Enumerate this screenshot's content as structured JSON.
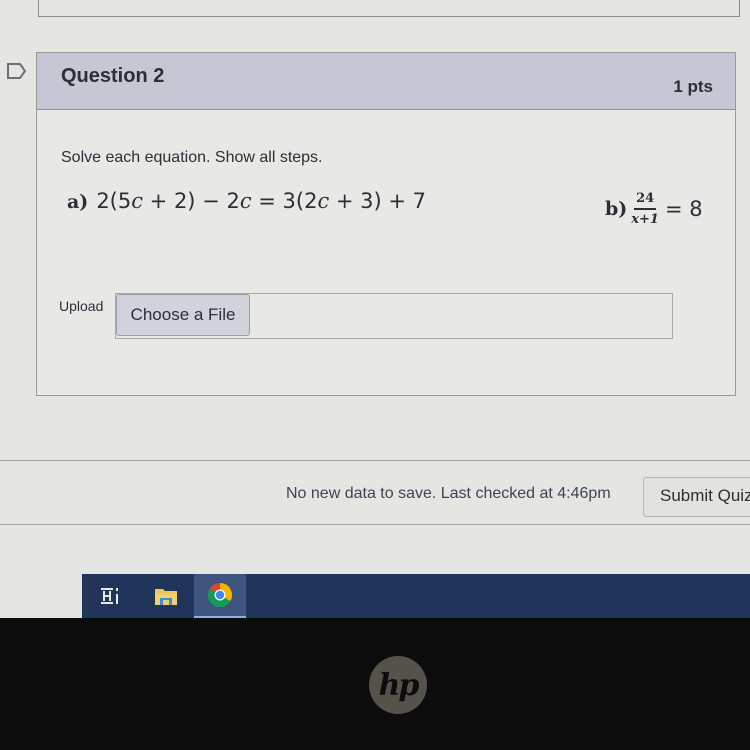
{
  "question": {
    "title": "Question 2",
    "points": "1 pts",
    "prompt": "Solve each equation. Show all steps.",
    "equation_a": {
      "label": "a)",
      "parts": [
        "2(5",
        "c",
        " + 2) − 2",
        "c",
        " = 3(2",
        "c",
        " + 3) + 7"
      ]
    },
    "equation_b": {
      "label": "b)",
      "numerator": "24",
      "denominator": "x+1",
      "rhs": "= 8"
    },
    "upload": {
      "label": "Upload",
      "button_label": "Choose a File",
      "file_value": ""
    }
  },
  "footer": {
    "status": "No new data to save. Last checked at 4:46pm",
    "submit_label": "Submit Quiz"
  },
  "taskbar": {
    "items": [
      {
        "name": "task-view",
        "icon": "task-view-icon"
      },
      {
        "name": "file-explorer",
        "icon": "folder-icon"
      },
      {
        "name": "chrome",
        "icon": "chrome-icon",
        "active": true
      }
    ]
  },
  "device": {
    "logo": "hp"
  }
}
